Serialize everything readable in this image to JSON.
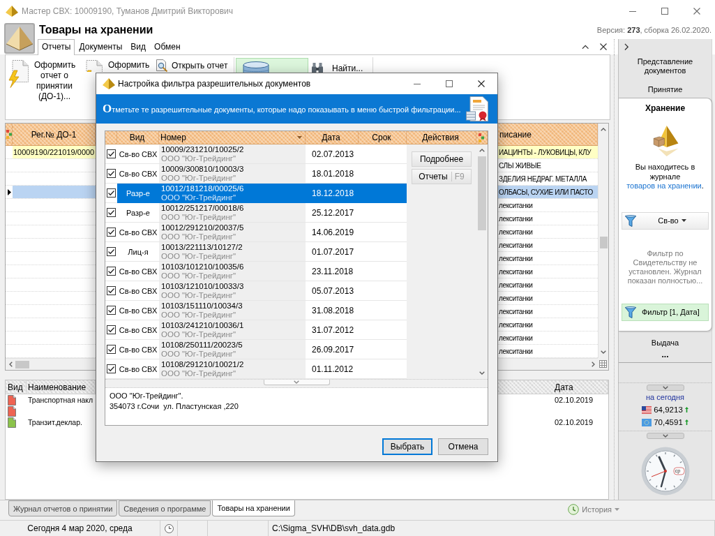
{
  "window": {
    "title": "Мастер СВХ: 10009190, Туманов Дмитрий Викторович"
  },
  "header": {
    "title": "Товары на хранении",
    "version": "Версия: **273**, сборка 26.02.2020."
  },
  "ribbon": {
    "tabs": [
      {
        "label": "Отчеты",
        "selected": true
      },
      {
        "label": "Документы",
        "selected": false
      },
      {
        "label": "Вид",
        "selected": false
      },
      {
        "label": "Обмен",
        "selected": false
      }
    ],
    "buttons": [
      {
        "kind": "create",
        "label": "Оформить отчет о принятии (ДО-1)..."
      },
      {
        "kind": "create",
        "label": "Оформить"
      },
      {
        "kind": "open",
        "label": "Открыть отчет"
      },
      {
        "kind": "filter",
        "active": true
      },
      {
        "kind": "find",
        "label": "Найти..."
      }
    ]
  },
  "journal": {
    "columns": [
      {
        "label": "Рег.№ ДО-1"
      },
      {
        "label": "писание"
      }
    ],
    "rows": [
      {
        "reg_number": "10009190/221019/0000",
        "description": "ИАЦИНТЫ - ЛУКОВИЦЫ, КЛУ",
        "highlighted": true,
        "selected": false
      },
      {
        "description": "СЛЫ ЖИВЫЕ",
        "highlighted": false,
        "selected": false
      },
      {
        "description": "ЗДЕЛИЯ НЕДРАГ. МЕТАЛЛА",
        "highlighted": false,
        "selected": false
      },
      {
        "description": "ОЛБАСЫ, СУХИЕ ИЛИ ПАСТО",
        "highlighted": false,
        "selected": true
      },
      {
        "description": "лекситанки",
        "highlighted": false,
        "selected": false
      },
      {
        "description": "лекситанки",
        "highlighted": false,
        "selected": false
      },
      {
        "description": "лекситанки",
        "highlighted": false,
        "selected": false
      },
      {
        "description": "лекситанки",
        "highlighted": false,
        "selected": false
      },
      {
        "description": "лекситанки",
        "highlighted": false,
        "selected": false
      },
      {
        "description": "лекситанки",
        "highlighted": false,
        "selected": false
      },
      {
        "description": "лекситанки",
        "highlighted": false,
        "selected": false
      },
      {
        "description": "лекситанки",
        "highlighted": false,
        "selected": false
      },
      {
        "description": "лекситанки",
        "highlighted": false,
        "selected": false
      },
      {
        "description": "лекситанки",
        "highlighted": false,
        "selected": false
      },
      {
        "description": "лекситанки",
        "highlighted": false,
        "selected": false
      },
      {
        "description": "лекситанки",
        "highlighted": false,
        "selected": false
      }
    ]
  },
  "documents": {
    "columns": [
      {
        "label": "Вид"
      },
      {
        "label": "Наименование"
      },
      {
        "label": "Дата"
      }
    ],
    "rows": [
      {
        "color": "#ee6352",
        "name": "Транспортная накл",
        "date": "02.10.2019"
      },
      {
        "color": "#ee6352"
      },
      {
        "color": "#8bc34a",
        "name": "Транзит.деклар.",
        "date": "02.10.2019"
      }
    ]
  },
  "side_panel": {
    "title": "Представление документов",
    "sections": [
      {
        "label": "Принятие",
        "selected": false
      },
      {
        "label": "Хранение",
        "selected": true
      },
      {
        "label": "Выдача",
        "selected": false
      }
    ],
    "more": "...",
    "card": {
      "message": "Вы находитесь в журнале ",
      "link": "товаров на хранении",
      "message_end": ".",
      "filter_menu": "Св-во",
      "filter_note": "Фильтр по Свидетельству не установлен. Журнал показан полностью...",
      "filter_status": "Фильтр [1, Дата]"
    }
  },
  "rates": {
    "title": "на сегодня",
    "items": [
      {
        "kind": "usd",
        "value": "64,9213",
        "rising": true
      },
      {
        "kind": "eur",
        "value": "70,4591",
        "rising": true
      }
    ]
  },
  "clock": {
    "weekday": "ср"
  },
  "document_tabs": [
    {
      "label": "Журнал отчетов о принятии",
      "selected": false
    },
    {
      "label": "Сведения о программе",
      "selected": false
    },
    {
      "label": "Товары на хранении",
      "selected": true
    }
  ],
  "history": "История",
  "status_bar": {
    "date": "Сегодня 4 мар 2020, среда",
    "path": "C:\\Sigma_SVH\\DB\\svh_data.gdb"
  },
  "dialog": {
    "title": "Настройка фильтра разрешительных документов",
    "banner": "**О**тметьте те разрешительные документы, которые надо показывать в меню быстрой фильтрации...",
    "columns": [
      {
        "label": "Вид",
        "sorted": false
      },
      {
        "label": "Номер",
        "sorted": true
      },
      {
        "label": "Дата",
        "sorted": false
      },
      {
        "label": "Срок",
        "sorted": false
      },
      {
        "label": "Действия",
        "sorted": false
      }
    ],
    "rows": [
      {
        "checked": true,
        "type": "Св-во СВХ",
        "number": "10009/231210/10025/2",
        "company": "ООО \"Юг-Трейдинг\"",
        "date": "02.07.2013",
        "selected": false
      },
      {
        "checked": true,
        "type": "Св-во СВХ",
        "number": "10009/300810/10003/3",
        "company": "ООО \"Юг-Трейдинг\"",
        "date": "18.01.2018",
        "selected": false
      },
      {
        "checked": true,
        "type": "Разр-е",
        "number": "10012/181218/00025/6",
        "company": "ООО \"Юг-Трейдинг\"",
        "date": "18.12.2018",
        "selected": true
      },
      {
        "checked": true,
        "type": "Разр-е",
        "number": "10012/251217/00018/6",
        "company": "ООО \"Юг-Трейдинг\"",
        "date": "25.12.2017",
        "selected": false
      },
      {
        "checked": true,
        "type": "Св-во СВХ",
        "number": "10012/291210/20037/5",
        "company": "ООО \"Юг-Трейдинг\"",
        "date": "14.06.2019",
        "selected": false
      },
      {
        "checked": true,
        "type": "Лиц-я",
        "number": "10013/221113/10127/2",
        "company": "ООО \"Юг-Трейдинг\"",
        "date": "01.07.2017",
        "selected": false
      },
      {
        "checked": true,
        "type": "Св-во СВХ",
        "number": "10103/101210/10035/6",
        "company": "ООО \"Юг-Трейдинг\"",
        "date": "23.11.2018",
        "selected": false
      },
      {
        "checked": true,
        "type": "Св-во СВХ",
        "number": "10103/121010/10033/3",
        "company": "ООО \"Юг-Трейдинг\"",
        "date": "05.07.2013",
        "selected": false
      },
      {
        "checked": true,
        "type": "Св-во СВХ",
        "number": "10103/151110/10034/3",
        "company": "ООО \"Юг-Трейдинг\"",
        "date": "31.08.2018",
        "selected": false
      },
      {
        "checked": true,
        "type": "Св-во СВХ",
        "number": "10103/241210/10036/1",
        "company": "ООО \"Юг-Трейдинг\"",
        "date": "31.07.2012",
        "selected": false
      },
      {
        "checked": true,
        "type": "Св-во СВХ",
        "number": "10108/250111/20023/5",
        "company": "ООО \"Юг-Трейдинг\"",
        "date": "26.09.2017",
        "selected": false
      },
      {
        "checked": true,
        "type": "Св-во СВХ",
        "number": "10108/291210/10021/2",
        "company": "ООО \"Юг-Трейдинг\"",
        "date": "01.11.2012",
        "selected": false
      }
    ],
    "actions": [
      {
        "label": "Подробнее"
      },
      {
        "label": "Отчеты",
        "shortcut": "F9"
      }
    ],
    "details": {
      "company": "ООО \"Юг-Трейдинг\".",
      "address": "354073 г.Сочи  ул. Пластунская ,220"
    },
    "buttons": [
      {
        "label": "Выбрать",
        "default": true
      },
      {
        "label": "Отмена",
        "default": false
      }
    ]
  }
}
